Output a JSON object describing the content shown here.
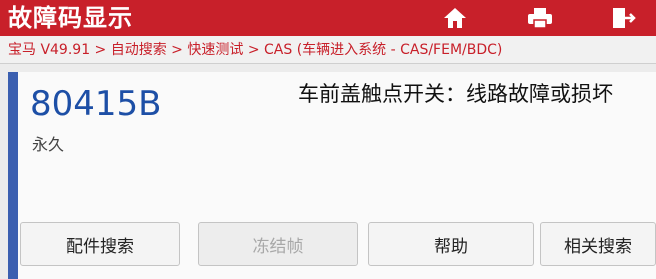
{
  "header": {
    "title": "故障码显示",
    "icons": [
      "home-icon",
      "print-icon",
      "exit-icon"
    ]
  },
  "breadcrumb": "宝马 V49.91 > 自动搜索 > 快速测试 > CAS (车辆进入系统 - CAS/FEM/BDC)",
  "fault": {
    "code": "80415B",
    "status": "永久",
    "description": "车前盖触点开关：线路故障或损坏"
  },
  "buttons": {
    "parts_search": "配件搜索",
    "freeze_frame": "冻结帧",
    "help": "帮助",
    "related_search": "相关搜索"
  },
  "colors": {
    "header_bg": "#c8202a",
    "accent": "#3b5fb0",
    "code_text": "#1d4fa6"
  }
}
